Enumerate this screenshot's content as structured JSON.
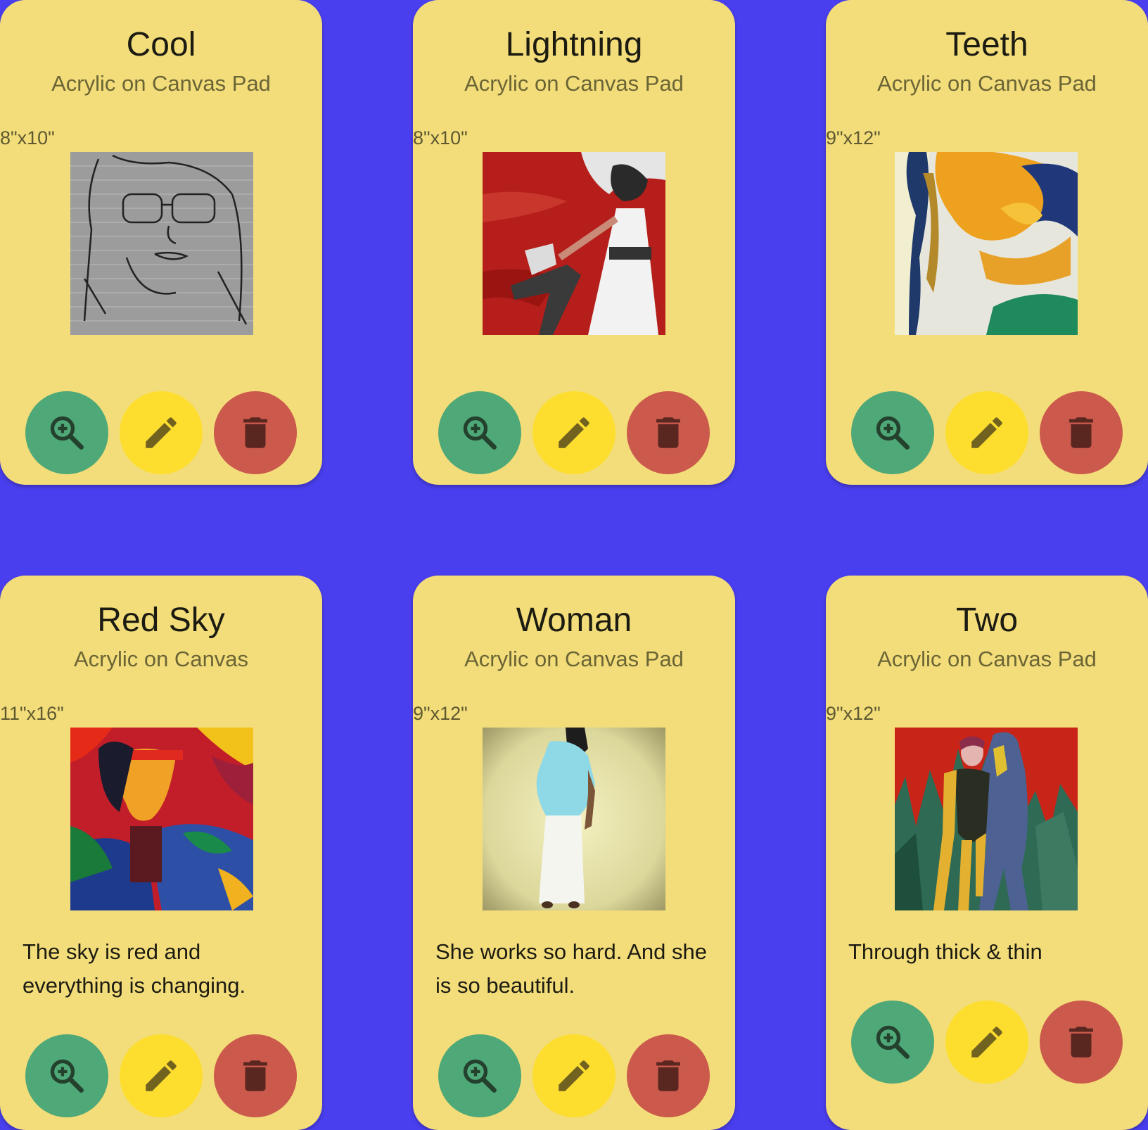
{
  "colors": {
    "background": "#4a3fef",
    "card": "#f3dd7a",
    "view_button": "#4fa877",
    "edit_button": "#fddd2e",
    "delete_button": "#cb5a4c"
  },
  "actions": {
    "view_icon": "zoom-in-icon",
    "edit_icon": "pencil-icon",
    "delete_icon": "trash-icon"
  },
  "paintings": [
    {
      "title": "Cool",
      "medium": "Acrylic on Canvas Pad",
      "size": "8\"x10\"",
      "description": ""
    },
    {
      "title": "Lightning",
      "medium": "Acrylic on Canvas Pad",
      "size": "8\"x10\"",
      "description": ""
    },
    {
      "title": "Teeth",
      "medium": "Acrylic on Canvas Pad",
      "size": "9\"x12\"",
      "description": ""
    },
    {
      "title": "Red Sky",
      "medium": "Acrylic on Canvas",
      "size": "11\"x16\"",
      "description": "The sky is red and everything is changing."
    },
    {
      "title": "Woman",
      "medium": "Acrylic on Canvas Pad",
      "size": "9\"x12\"",
      "description": "She works so hard. And she is so beautiful."
    },
    {
      "title": "Two",
      "medium": "Acrylic on Canvas Pad",
      "size": "9\"x12\"",
      "description": "Through thick & thin"
    }
  ]
}
